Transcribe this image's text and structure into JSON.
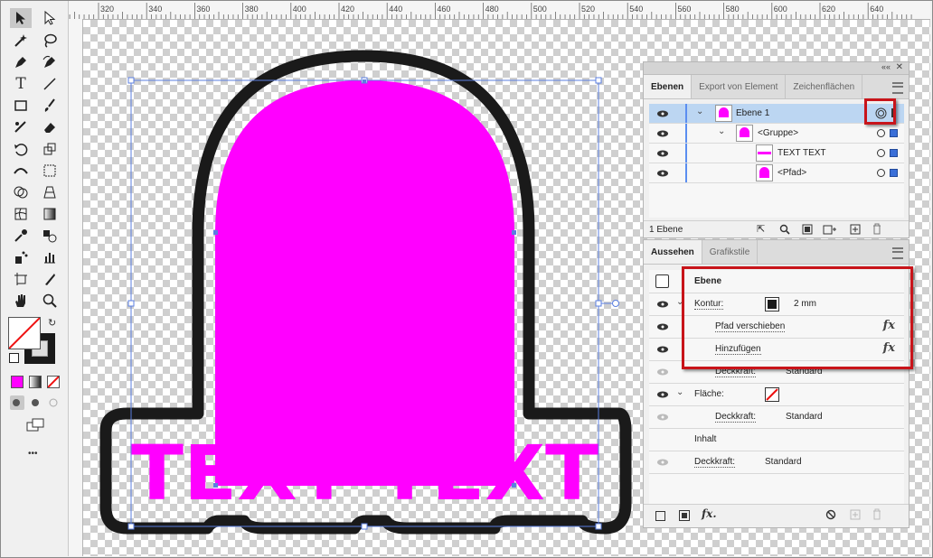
{
  "ruler": {
    "ticks": [
      "320",
      "340",
      "360",
      "380",
      "400",
      "420",
      "440",
      "460",
      "480",
      "500",
      "520",
      "540",
      "560",
      "580",
      "600",
      "620",
      "640"
    ]
  },
  "artwork": {
    "text": "TEXT TEXT",
    "fill_color": "#ff00ff",
    "stroke_color": "#1a1a1a"
  },
  "toolbar": {
    "tools": [
      "selection-tool",
      "direct-selection-tool",
      "magic-wand-tool",
      "lasso-tool",
      "pen-tool",
      "curvature-tool",
      "type-tool",
      "line-tool",
      "rectangle-tool",
      "paintbrush-tool",
      "shaper-tool",
      "eraser-tool",
      "rotate-tool",
      "scale-tool",
      "width-tool",
      "free-transform-tool",
      "shape-builder-tool",
      "perspective-tool",
      "mesh-tool",
      "gradient-tool",
      "eyedropper-tool",
      "blend-tool",
      "symbol-sprayer-tool",
      "graph-tool",
      "artboard-tool",
      "slice-tool",
      "hand-tool",
      "zoom-tool"
    ],
    "more_label": "•••"
  },
  "colors": {
    "accent": "#3a6fd8",
    "highlight": "#c8141a",
    "magenta": "#ff00ff"
  },
  "layers_panel": {
    "tabs": [
      "Ebenen",
      "Export von Element",
      "Zeichenflächen"
    ],
    "rows": [
      {
        "name": "Ebene 1",
        "selected": true
      },
      {
        "name": "<Gruppe>"
      },
      {
        "name": "TEXT TEXT"
      },
      {
        "name": "<Pfad>"
      }
    ],
    "footer": "1 Ebene"
  },
  "appearance_panel": {
    "tabs": [
      "Aussehen",
      "Grafikstile"
    ],
    "header": "Ebene",
    "kontur_label": "Kontur:",
    "kontur_value": "2 mm",
    "pfad_label": "Pfad verschieben",
    "hinzu_label": "Hinzufügen",
    "deckkraft1_label": "Deckkraft:",
    "deckkraft1_value": "Standard",
    "flaeche_label": "Fläche:",
    "deckkraft2_label": "Deckkraft:",
    "deckkraft2_value": "Standard",
    "inhalt_label": "Inhalt",
    "deckkraft3_label": "Deckkraft:",
    "deckkraft3_value": "Standard",
    "fx_symbol": "fx"
  }
}
